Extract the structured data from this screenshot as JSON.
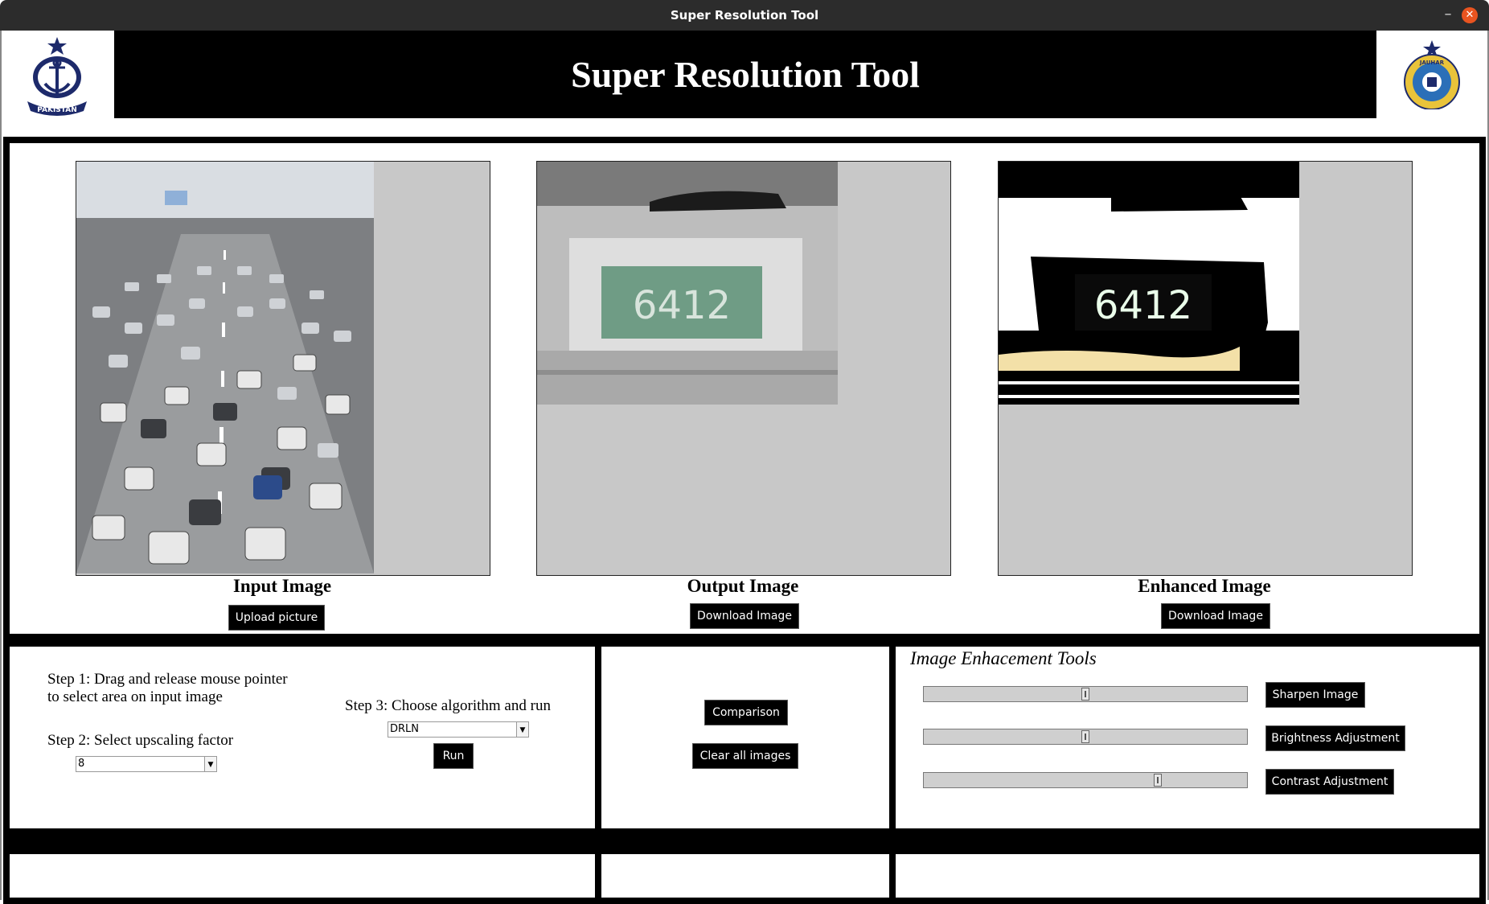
{
  "window": {
    "title": "Super Resolution Tool",
    "minimize": "–",
    "close": "✕"
  },
  "header": {
    "title": "Super Resolution Tool",
    "logo_left_text": "PAKISTAN",
    "logo_right_text": "JAUHAR"
  },
  "images": {
    "input": {
      "caption": "Input Image",
      "button": "Upload picture"
    },
    "output": {
      "caption": "Output Image",
      "button": "Download Image",
      "plate_text": "6412"
    },
    "enhanced": {
      "caption": "Enhanced Image",
      "button": "Download Image",
      "plate_text": "6412"
    }
  },
  "steps": {
    "step1": "Step 1: Drag and release mouse pointer",
    "step1b": "to select area on input image",
    "step2": "Step 2: Select upscaling factor",
    "scale_value": "8",
    "step3": "Step 3: Choose algorithm and run",
    "algorithm_value": "DRLN",
    "run": "Run"
  },
  "actions": {
    "comparison": "Comparison",
    "clear": "Clear all images"
  },
  "enhancement": {
    "title": "Image Enhacement Tools",
    "sharpen": {
      "label": "Sharpen Image",
      "level": 0.5
    },
    "brightness": {
      "label": "Brightness Adjustment",
      "level": 0.5
    },
    "contrast": {
      "label": "Contrast Adjustment",
      "level": 0.73
    }
  },
  "colors": {
    "panel_border": "#000000",
    "frame_bg": "#c8c8c8",
    "close_button": "#e95420"
  }
}
